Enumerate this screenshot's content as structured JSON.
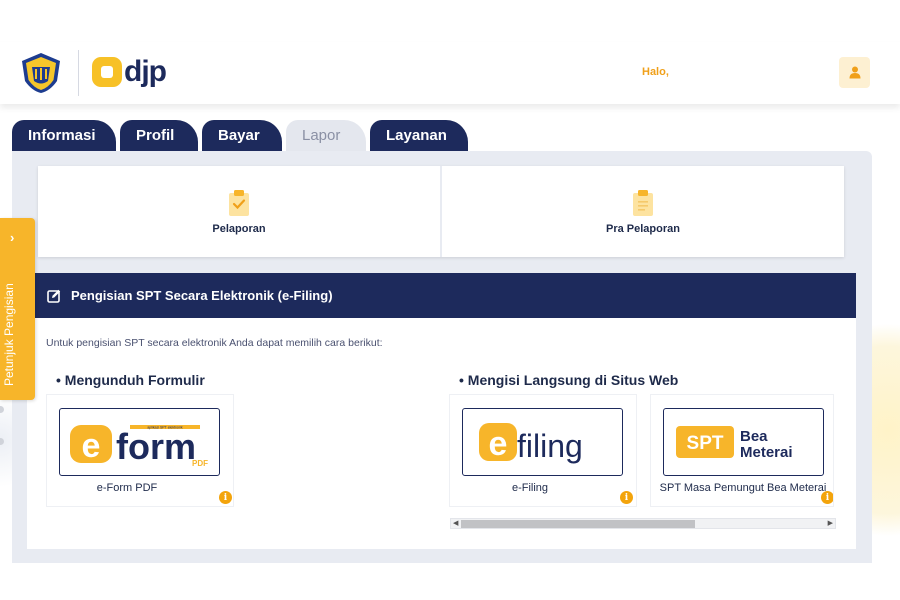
{
  "header": {
    "logo_text": "djp",
    "greeting": "Halo,",
    "user_icon": "user-icon"
  },
  "tabs": [
    {
      "label": "Informasi",
      "active": false
    },
    {
      "label": "Profil",
      "active": false
    },
    {
      "label": "Bayar",
      "active": false
    },
    {
      "label": "Lapor",
      "active": true
    },
    {
      "label": "Layanan",
      "active": false
    }
  ],
  "cards": [
    {
      "label": "Pelaporan",
      "icon": "clipboard-check-icon"
    },
    {
      "label": "Pra Pelaporan",
      "icon": "clipboard-icon"
    }
  ],
  "section": {
    "title": "Pengisian SPT Secara Elektronik (e-Filing)",
    "icon": "edit-icon",
    "intro": "Untuk pengisian SPT secara elektronik Anda dapat memilih cara berikut:",
    "subtitle_download": "• Mengunduh Formulir",
    "subtitle_web": "• Mengisi Langsung di Situs Web"
  },
  "options": [
    {
      "label": "e-Form PDF",
      "logo_word": "form",
      "logo_small": "PDF",
      "logo_tagline": "aplikasi SPT elektronik"
    },
    {
      "label": "e-Filing",
      "logo_word": "filing"
    },
    {
      "label": "SPT Masa Pemungut Bea Meterai",
      "logo_word": "SPT",
      "logo_word2": "Bea",
      "logo_word3": "Meterai"
    }
  ],
  "side_panel": {
    "label": "Petunjuk Pengisian",
    "arrow": "›"
  },
  "colors": {
    "navy": "#1d2a5c",
    "accent": "#f7b52a",
    "info": "#f3a40c"
  }
}
